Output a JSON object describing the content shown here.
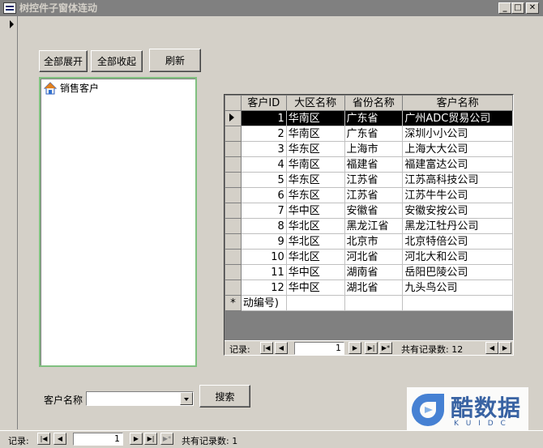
{
  "window": {
    "title": "树控件子窗体连动"
  },
  "toolbar": {
    "expand_all": "全部展开",
    "collapse_all": "全部收起",
    "refresh": "刷新"
  },
  "tree": {
    "root_label": "销售客户"
  },
  "grid": {
    "columns": [
      "客户ID",
      "大区名称",
      "省份名称",
      "客户名称"
    ],
    "rows": [
      {
        "id": "1",
        "region": "华南区",
        "province": "广东省",
        "name": "广州ADC贸易公司"
      },
      {
        "id": "2",
        "region": "华南区",
        "province": "广东省",
        "name": "深圳小小公司"
      },
      {
        "id": "3",
        "region": "华东区",
        "province": "上海市",
        "name": "上海大大公司"
      },
      {
        "id": "4",
        "region": "华南区",
        "province": "福建省",
        "name": "福建富达公司"
      },
      {
        "id": "5",
        "region": "华东区",
        "province": "江苏省",
        "name": "江苏高科技公司"
      },
      {
        "id": "6",
        "region": "华东区",
        "province": "江苏省",
        "name": "江苏牛牛公司"
      },
      {
        "id": "7",
        "region": "华中区",
        "province": "安徽省",
        "name": "安徽安按公司"
      },
      {
        "id": "8",
        "region": "华北区",
        "province": "黑龙江省",
        "name": "黑龙江牡丹公司"
      },
      {
        "id": "9",
        "region": "华北区",
        "province": "北京市",
        "name": "北京特倍公司"
      },
      {
        "id": "10",
        "region": "华北区",
        "province": "河北省",
        "name": "河北大和公司"
      },
      {
        "id": "11",
        "region": "华中区",
        "province": "湖南省",
        "name": "岳阳巴陵公司"
      },
      {
        "id": "12",
        "region": "华中区",
        "province": "湖北省",
        "name": "九头鸟公司"
      }
    ],
    "new_row_id": "动编号)",
    "new_row_marker": "*"
  },
  "subnav": {
    "label": "记录:",
    "current": "1",
    "total_text": "共有记录数: 12"
  },
  "search": {
    "label": "客户名称",
    "value": "",
    "button": "搜索"
  },
  "mainnav": {
    "label": "记录:",
    "current": "1",
    "total_text": "共有记录数: 1"
  },
  "watermark": {
    "brand": "酷数据",
    "letters": "K U I D C"
  }
}
